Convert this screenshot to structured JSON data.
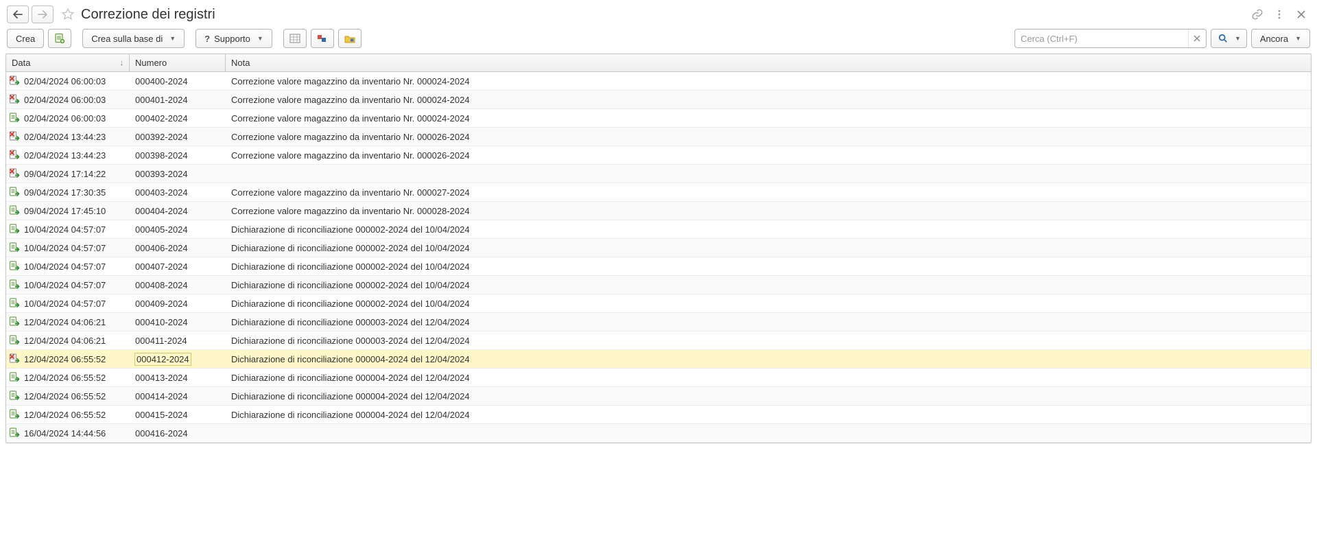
{
  "header": {
    "title": "Correzione dei registri"
  },
  "toolbar": {
    "create_label": "Crea",
    "create_based_on_label": "Crea sulla base di",
    "support_label": "Supporto",
    "more_label": "Ancora",
    "search_placeholder": "Cerca (Ctrl+F)",
    "support_question": "?"
  },
  "columns": {
    "date": "Data",
    "number": "Numero",
    "note": "Nota"
  },
  "rows": [
    {
      "icon": "red",
      "date": "02/04/2024 06:00:03",
      "num": "000400-2024",
      "note": "Correzione valore magazzino da inventario Nr. 000024-2024",
      "selected": false
    },
    {
      "icon": "red",
      "date": "02/04/2024 06:00:03",
      "num": "000401-2024",
      "note": "Correzione valore magazzino da inventario Nr. 000024-2024",
      "selected": false
    },
    {
      "icon": "green",
      "date": "02/04/2024 06:00:03",
      "num": "000402-2024",
      "note": "Correzione valore magazzino da inventario Nr. 000024-2024",
      "selected": false
    },
    {
      "icon": "red",
      "date": "02/04/2024 13:44:23",
      "num": "000392-2024",
      "note": "Correzione valore magazzino da inventario Nr. 000026-2024",
      "selected": false
    },
    {
      "icon": "red",
      "date": "02/04/2024 13:44:23",
      "num": "000398-2024",
      "note": "Correzione valore magazzino da inventario Nr. 000026-2024",
      "selected": false
    },
    {
      "icon": "red",
      "date": "09/04/2024 17:14:22",
      "num": "000393-2024",
      "note": "",
      "selected": false
    },
    {
      "icon": "green",
      "date": "09/04/2024 17:30:35",
      "num": "000403-2024",
      "note": "Correzione valore magazzino da inventario Nr. 000027-2024",
      "selected": false
    },
    {
      "icon": "green",
      "date": "09/04/2024 17:45:10",
      "num": "000404-2024",
      "note": "Correzione valore magazzino da inventario Nr. 000028-2024",
      "selected": false
    },
    {
      "icon": "green",
      "date": "10/04/2024 04:57:07",
      "num": "000405-2024",
      "note": "Dichiarazione di riconciliazione 000002-2024 del 10/04/2024",
      "selected": false
    },
    {
      "icon": "green",
      "date": "10/04/2024 04:57:07",
      "num": "000406-2024",
      "note": "Dichiarazione di riconciliazione 000002-2024 del 10/04/2024",
      "selected": false
    },
    {
      "icon": "green",
      "date": "10/04/2024 04:57:07",
      "num": "000407-2024",
      "note": "Dichiarazione di riconciliazione 000002-2024 del 10/04/2024",
      "selected": false
    },
    {
      "icon": "green",
      "date": "10/04/2024 04:57:07",
      "num": "000408-2024",
      "note": "Dichiarazione di riconciliazione 000002-2024 del 10/04/2024",
      "selected": false
    },
    {
      "icon": "green",
      "date": "10/04/2024 04:57:07",
      "num": "000409-2024",
      "note": "Dichiarazione di riconciliazione 000002-2024 del 10/04/2024",
      "selected": false
    },
    {
      "icon": "green",
      "date": "12/04/2024 04:06:21",
      "num": "000410-2024",
      "note": "Dichiarazione di riconciliazione 000003-2024 del 12/04/2024",
      "selected": false
    },
    {
      "icon": "green",
      "date": "12/04/2024 04:06:21",
      "num": "000411-2024",
      "note": "Dichiarazione di riconciliazione 000003-2024 del 12/04/2024",
      "selected": false
    },
    {
      "icon": "red",
      "date": "12/04/2024 06:55:52",
      "num": "000412-2024",
      "note": "Dichiarazione di riconciliazione 000004-2024 del 12/04/2024",
      "selected": true
    },
    {
      "icon": "green",
      "date": "12/04/2024 06:55:52",
      "num": "000413-2024",
      "note": "Dichiarazione di riconciliazione 000004-2024 del 12/04/2024",
      "selected": false
    },
    {
      "icon": "green",
      "date": "12/04/2024 06:55:52",
      "num": "000414-2024",
      "note": "Dichiarazione di riconciliazione 000004-2024 del 12/04/2024",
      "selected": false
    },
    {
      "icon": "green",
      "date": "12/04/2024 06:55:52",
      "num": "000415-2024",
      "note": "Dichiarazione di riconciliazione 000004-2024 del 12/04/2024",
      "selected": false
    },
    {
      "icon": "green",
      "date": "16/04/2024 14:44:56",
      "num": "000416-2024",
      "note": "",
      "selected": false
    }
  ]
}
